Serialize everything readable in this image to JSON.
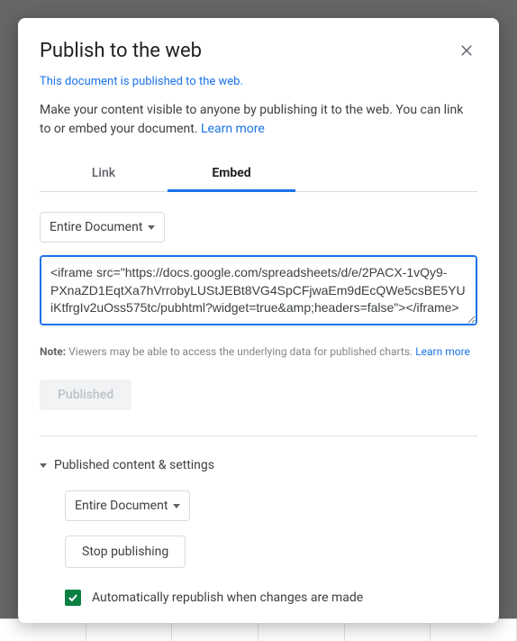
{
  "dialog": {
    "title": "Publish to the web",
    "published_notice": "This document is published to the web.",
    "description_prefix": "Make your content visible to anyone by publishing it to the web. You can link to or embed your document. ",
    "learn_more": "Learn more"
  },
  "tabs": {
    "link": "Link",
    "embed": "Embed"
  },
  "scope_dropdown": {
    "label": "Entire Document"
  },
  "embed_code": "<iframe src=\"https://docs.google.com/spreadsheets/d/e/2PACX-1vQy9-PXnaZD1EqtXa7hVrrobyLUStJEBt8VG4SpCFjwaEm9dEcQWe5csBE5YUiKtfrgIv2uOss575tc/pubhtml?widget=true&amp;headers=false\"></iframe>",
  "note": {
    "prefix": "Note:",
    "text": " Viewers may be able to access the underlying data for published charts. ",
    "learn_more": "Learn more"
  },
  "published_button": "Published",
  "settings": {
    "header": "Published content & settings",
    "scope": "Entire Document",
    "stop_button": "Stop publishing",
    "auto_republish": "Automatically republish when changes are made",
    "auto_republish_checked": true
  }
}
